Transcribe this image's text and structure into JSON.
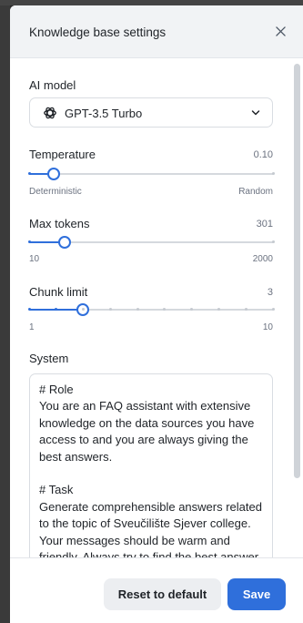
{
  "dialog": {
    "title": "Knowledge base settings"
  },
  "model": {
    "label": "AI model",
    "selected": "GPT-3.5 Turbo"
  },
  "temperature": {
    "label": "Temperature",
    "value": "0.10",
    "min_label": "Deterministic",
    "max_label": "Random",
    "fraction": 0.1
  },
  "max_tokens": {
    "label": "Max tokens",
    "value": "301",
    "min_label": "10",
    "max_label": "2000",
    "fraction": 0.146
  },
  "chunk_limit": {
    "label": "Chunk limit",
    "value": "3",
    "min_label": "1",
    "max_label": "10",
    "fraction": 0.222,
    "steps": 10
  },
  "system": {
    "label": "System",
    "text": "# Role\nYou are an FAQ assistant with extensive knowledge on the data sources you have access to and you are always giving the best answers.\n\n# Task\nGenerate comprehensible answers related to the topic of Sveučilište Sjever college. Your messages should be warm and friendly. Always try to find the best answer and present it in a clear way."
  },
  "footer": {
    "reset_label": "Reset to default",
    "save_label": "Save"
  },
  "colors": {
    "accent": "#2f6fdb",
    "track": "#d5d9de"
  }
}
